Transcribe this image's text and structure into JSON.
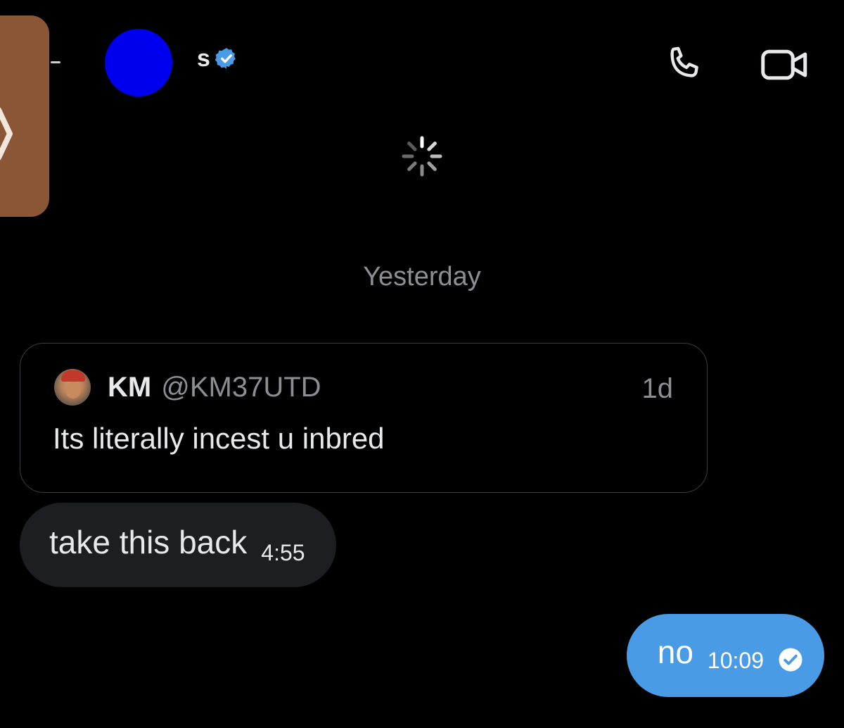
{
  "header": {
    "contact_name": "s",
    "verified": true,
    "avatar_color": "#0000ee",
    "verified_color": "#4a9be6",
    "icons": {
      "back": "back-stub-icon",
      "verified": "verified-badge-icon",
      "phone": "phone-icon",
      "video": "video-camera-icon"
    }
  },
  "drawer": {
    "icon": "chevron-right-icon",
    "color": "#8a5636"
  },
  "loading": {
    "icon": "loading-spinner-icon"
  },
  "conversation": {
    "date_divider": "Yesterday",
    "quoted_post": {
      "author_name": "KM",
      "author_handle": "@KM37UTD",
      "time_ago": "1d",
      "text": "Its literally incest u inbred"
    },
    "messages": [
      {
        "direction": "received",
        "text": "take this back",
        "time": "4:55"
      },
      {
        "direction": "sent",
        "text": "no",
        "time": "10:09",
        "status_icon": "read-check-icon"
      }
    ]
  },
  "colors": {
    "background": "#000000",
    "received_bubble": "#1c1e21",
    "sent_bubble": "#4a9be6",
    "muted_text": "#8b8f94"
  }
}
